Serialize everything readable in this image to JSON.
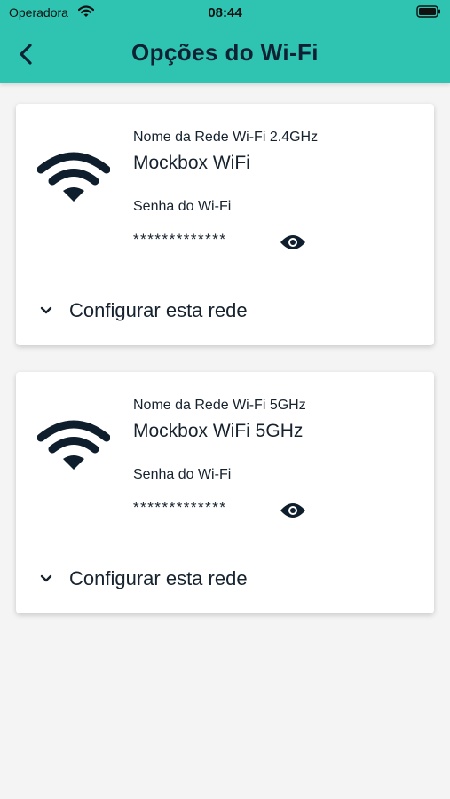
{
  "status_bar": {
    "carrier": "Operadora",
    "time": "08:44"
  },
  "header": {
    "title": "Opções do Wi-Fi",
    "background": "#2ec4b1"
  },
  "networks": [
    {
      "label": "Nome da Rede Wi-Fi 2.4GHz",
      "name": "Mockbox WiFi",
      "password_label": "Senha do Wi-Fi",
      "password_masked": "*************",
      "configure_label": "Configurar esta rede",
      "icon": "wifi-icon"
    },
    {
      "label": "Nome da Rede Wi-Fi 5GHz",
      "name": "Mockbox WiFi 5GHz",
      "password_label": "Senha do Wi-Fi",
      "password_masked": "*************",
      "configure_label": "Configurar esta rede",
      "icon": "wifi-icon"
    }
  ]
}
